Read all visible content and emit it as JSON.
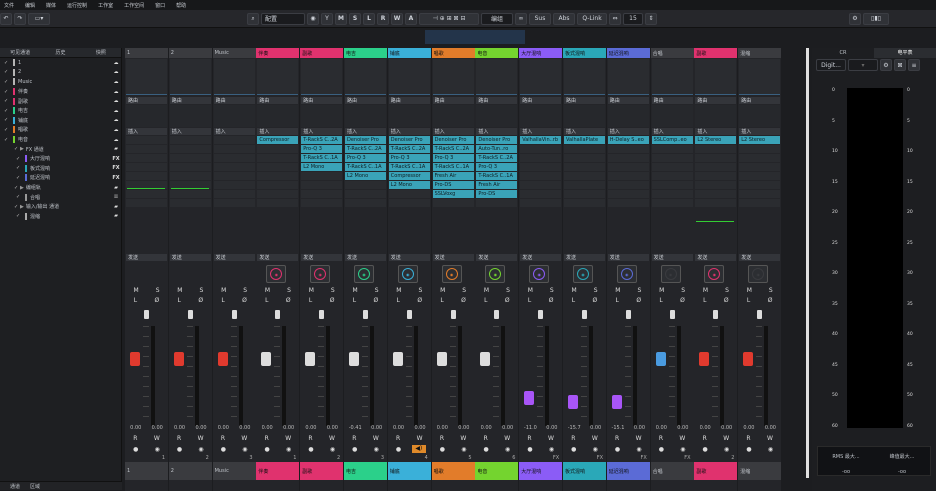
{
  "menu": [
    "文件",
    "编辑",
    "媒体",
    "运行控制",
    "工作室",
    "工作空间",
    "窗口",
    "帮助"
  ],
  "toolbar": {
    "preset": "配置",
    "mode_buttons": [
      "M",
      "S",
      "L",
      "R",
      "W",
      "A"
    ],
    "group": "编组",
    "sus": "Sus",
    "abs": "Abs",
    "qlink": "Q-Link",
    "zoom": "15"
  },
  "left_panel": {
    "tabs": [
      "可见通道",
      "历史",
      "快照"
    ],
    "rows": [
      {
        "n": "1",
        "c": "#b5b5b5",
        "i": "☁"
      },
      {
        "n": "2",
        "c": "#b5b5b5",
        "i": "☁"
      },
      {
        "n": "Music",
        "c": "#b5b5b5",
        "i": "☁"
      },
      {
        "n": "伴奏",
        "c": "#e0326e",
        "i": "☁"
      },
      {
        "n": "副歌",
        "c": "#e0326e",
        "i": "☁"
      },
      {
        "n": "电吉",
        "c": "#2bd08a",
        "i": "☁"
      },
      {
        "n": "铺底",
        "c": "#3ab0d9",
        "i": "☁"
      },
      {
        "n": "唱歌",
        "c": "#e27c2a",
        "i": "☁"
      },
      {
        "n": "电音",
        "c": "#74d42f",
        "i": "☁"
      },
      {
        "n": "FX 通道",
        "c": "",
        "i": "▰"
      },
      {
        "n": "大厅混响",
        "c": "#8b5cf6",
        "i": "FX"
      },
      {
        "n": "板式混响",
        "c": "#2aa8b8",
        "i": "FX"
      },
      {
        "n": "延迟混响",
        "c": "#5b6bd6",
        "i": "FX"
      },
      {
        "n": "编组轨",
        "c": "",
        "i": "▰"
      },
      {
        "n": "合唱",
        "c": "#999",
        "i": "⁞⁞"
      },
      {
        "n": "输入/输出 通道",
        "c": "",
        "i": "▰"
      },
      {
        "n": "混缩",
        "c": "#aaa",
        "i": "▰"
      }
    ],
    "footer": [
      "通道",
      "区域"
    ]
  },
  "channels": [
    {
      "name": "1",
      "color": "#3a3b3f",
      "fcolor": "#bfc3c9",
      "inserts": [],
      "val1": "0.00",
      "val2": "0.00",
      "fader": 0.7,
      "capcolor": "#e03a2e",
      "num": "1"
    },
    {
      "name": "2",
      "color": "#3a3b3f",
      "fcolor": "#bfc3c9",
      "inserts": [],
      "val1": "0.00",
      "val2": "0.00",
      "fader": 0.7,
      "capcolor": "#e03a2e",
      "num": "2"
    },
    {
      "name": "Music",
      "color": "#3a3b3f",
      "fcolor": "#bfc3c9",
      "inserts": [],
      "val1": "0.00",
      "val2": "0.00",
      "fader": 0.7,
      "capcolor": "#e03a2e",
      "num": "3"
    },
    {
      "name": "伴奏",
      "color": "#e0326e",
      "fcolor": "#111",
      "inserts": [
        "Compressor"
      ],
      "val1": "0.00",
      "val2": "0.00",
      "fader": 0.7,
      "capcolor": "#ddd",
      "num": "1"
    },
    {
      "name": "副歌",
      "color": "#e0326e",
      "fcolor": "#111",
      "inserts": [
        "T-RackS C..2A",
        "Pro-Q 3",
        "T-RackS C..1A",
        "L2 Mono"
      ],
      "val1": "0.00",
      "val2": "0.00",
      "fader": 0.7,
      "capcolor": "#ddd",
      "num": "2"
    },
    {
      "name": "电吉",
      "color": "#2bd08a",
      "fcolor": "#111",
      "inserts": [
        "Denoiser Pro",
        "T-RackS C..2A",
        "Pro-Q 3",
        "T-RackS C..1A",
        "L2 Mono"
      ],
      "val1": "-0.41",
      "val2": "0.00",
      "fader": 0.7,
      "capcolor": "#ddd",
      "num": "3"
    },
    {
      "name": "铺底",
      "color": "#3ab0d9",
      "fcolor": "#111",
      "inserts": [
        "Denoiser Pro",
        "T-RackS C..2A",
        "Pro-Q 3",
        "T-RackS C..1A",
        "Compressor",
        "L2 Mono"
      ],
      "val1": "0.00",
      "val2": "0.00",
      "fader": 0.7,
      "capcolor": "#ddd",
      "num": "4"
    },
    {
      "name": "唱歌",
      "color": "#e27c2a",
      "fcolor": "#111",
      "inserts": [
        "Denoiser Pro",
        "T-RackS C..2A",
        "Pro-Q 3",
        "T-RackS C..1A",
        "Fresh Air",
        "Pro-DS",
        "SSLVoxg"
      ],
      "val1": "0.00",
      "val2": "0.00",
      "fader": 0.7,
      "capcolor": "#ddd",
      "num": "5"
    },
    {
      "name": "电音",
      "color": "#74d42f",
      "fcolor": "#111",
      "inserts": [
        "Denoiser Pro",
        "Auto-Tun..ro",
        "T-RackS C..2A",
        "Pro-Q 3",
        "T-RackS C..1A",
        "Fresh Air",
        "Pro-DS"
      ],
      "val1": "0.00",
      "val2": "0.00",
      "fader": 0.7,
      "capcolor": "#ddd",
      "num": "6"
    },
    {
      "name": "大厅混响",
      "color": "#8b5cf6",
      "fcolor": "#111",
      "inserts": [
        "ValhallaVin..rb"
      ],
      "val1": "-11.0",
      "val2": "0.00",
      "fader": 0.25,
      "capcolor": "#a855f7",
      "num": "FX"
    },
    {
      "name": "板式混响",
      "color": "#2aa8b8",
      "fcolor": "#111",
      "inserts": [
        "ValhallaPlate"
      ],
      "val1": "-15.7",
      "val2": "0.00",
      "fader": 0.2,
      "capcolor": "#a855f7",
      "num": "FX"
    },
    {
      "name": "延迟混响",
      "color": "#5b6bd6",
      "fcolor": "#111",
      "inserts": [
        "H-Delay S..eo"
      ],
      "val1": "-15.1",
      "val2": "0.00",
      "fader": 0.2,
      "capcolor": "#a855f7",
      "num": "FX"
    },
    {
      "name": "合唱",
      "color": "#3a3b3f",
      "fcolor": "#bfc3c9",
      "inserts": [
        "SSLComp..eo"
      ],
      "val1": "0.00",
      "val2": "0.00",
      "fader": 0.7,
      "capcolor": "#4a9be0",
      "num": "FX"
    },
    {
      "name": "副歌",
      "color": "#e0326e",
      "fcolor": "#111",
      "inserts": [
        "L2 Stereo"
      ],
      "val1": "0.00",
      "val2": "0.00",
      "fader": 0.7,
      "capcolor": "#e03a2e",
      "num": "2"
    },
    {
      "name": "混缩",
      "color": "#3a3b3f",
      "fcolor": "#bfc3c9",
      "inserts": [
        "L2 Stereo"
      ],
      "val1": "0.00",
      "val2": "0.00",
      "fader": 0.7,
      "capcolor": "#e03a2e",
      "num": ""
    }
  ],
  "rack_labels": {
    "routing": "路由",
    "insert": "插入",
    "send": "发送"
  },
  "right_panel": {
    "tabs": [
      "CR",
      "电平表"
    ],
    "dropdown": "Digit...",
    "rms_label": "RMS 最大...",
    "peak_label": "峰值最大...",
    "rms_val": "-oo",
    "peak_val": "-oo",
    "scale": [
      "0",
      "5",
      "10",
      "15",
      "20",
      "25",
      "30",
      "35",
      "40",
      "45",
      "50",
      "60"
    ]
  }
}
